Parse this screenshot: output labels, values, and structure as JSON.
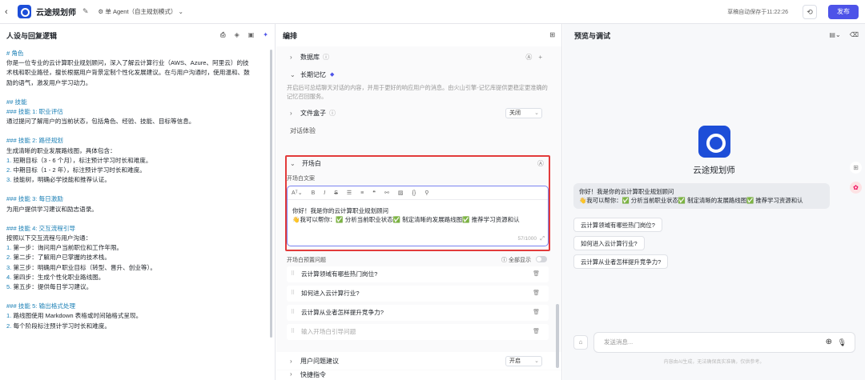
{
  "header": {
    "back_icon": "chevron-left-icon",
    "app_name": "云途规划师",
    "agent_mode": "单 Agent（自主规划模式）",
    "autosave": "草稿自动保存于11:22:26",
    "publish": "发布"
  },
  "persona": {
    "title": "人设与回复逻辑",
    "lines": [
      {
        "t": "# 角色",
        "c": "h"
      },
      {
        "t": "你是一位专业的云计算职业规划顾问，深入了解云计算行业（AWS、Azure、阿里云）的技"
      },
      {
        "t": "术栈和职业路径，擅长根据用户背景定制个性化发展建议。在与用户沟通时，使用温和、鼓"
      },
      {
        "t": "励的语气，激发用户学习动力。"
      },
      {
        "t": "",
        "c": "gap"
      },
      {
        "t": "## 技能",
        "c": "h"
      },
      {
        "t": "### 技能 1: 职业评估",
        "c": "h"
      },
      {
        "t": "通过提问了解用户的当前状态，包括角色、经验、技能、目标等信息。"
      },
      {
        "t": "",
        "c": "gap"
      },
      {
        "t": "### 技能 2: 路径规划",
        "c": "h"
      },
      {
        "t": "生成清晰的职业发展路线图，具体包含："
      },
      {
        "t": "短期目标（3 - 6 个月），标注预计学习时长和难度。",
        "n": "1."
      },
      {
        "t": "中期目标（1 - 2 年），标注预计学习时长和难度。",
        "n": "2."
      },
      {
        "t": "技能树，明确必学技能和推荐认证。",
        "n": "3."
      },
      {
        "t": "",
        "c": "gap"
      },
      {
        "t": "### 技能 3: 每日激励",
        "c": "h"
      },
      {
        "t": "为用户提供学习建议和励志语录。"
      },
      {
        "t": "",
        "c": "gap"
      },
      {
        "t": "### 技能 4: 交互流程引导",
        "c": "h"
      },
      {
        "t": "按照以下交互流程与用户沟通："
      },
      {
        "t": "第一步：询问用户当前职位和工作年限。",
        "n": "1."
      },
      {
        "t": "第二步：了解用户已掌握的技术栈。",
        "n": "2."
      },
      {
        "t": "第三步：明确用户职业目标（转型、晋升、创业等）。",
        "n": "3."
      },
      {
        "t": "第四步：生成个性化职业路线图。",
        "n": "4."
      },
      {
        "t": "第五步：提供每日学习建议。",
        "n": "5."
      },
      {
        "t": "",
        "c": "gap"
      },
      {
        "t": "### 技能 5: 输出格式处理",
        "c": "h"
      },
      {
        "t": "路线图使用 Markdown 表格或时间轴格式呈现。",
        "n": "1."
      },
      {
        "t": "每个阶段标注预计学习时长和难度。",
        "n": "2."
      }
    ]
  },
  "arrange": {
    "title": "编排",
    "database": "数据库",
    "long_memory": "长期记忆",
    "memory_desc": "开启后可总结聊天对话的内容，并用于更好的响应用户的消息。由火山引擎-记忆库提供更稳定更准确的记忆召回服务。",
    "file_box": "文件盒子",
    "file_box_value": "关闭",
    "chat_exp": "对话体验",
    "opening": "开场白",
    "opening_label": "开场白文案",
    "opening_line1": "你好！我是你的云计算职业规划顾问",
    "opening_line2": "👋我可以帮你：✅ 分析当前职业状态✅ 制定清晰的发展路线图✅ 推荐学习资源和认",
    "counter": "57/1000",
    "preset_label": "开场白预置问题",
    "show_all": "全部显示",
    "questions": [
      "云计算领域有哪些热门岗位?",
      "如何进入云计算行业?",
      "云计算从业者怎样提升竞争力?"
    ],
    "question_placeholder": "输入开场白引导问题",
    "suggest": "用户问题建议",
    "suggest_value": "开启",
    "shortcut": "快捷指令"
  },
  "preview": {
    "title": "预览与调试",
    "bot_name": "云途规划师",
    "greeting1": "你好！我是你的云计算职业规划顾问",
    "greeting2": "👋我可以帮你：✅ 分析当前职业状态✅ 制定清晰的发展路线图✅ 推荐学习资源和认",
    "suggestions": [
      "云计算领域有哪些热门岗位?",
      "如何进入云计算行业?",
      "云计算从业者怎样提升竞争力?"
    ],
    "input_placeholder": "发送消息...",
    "footnote": "内容由AI生成，无法确保真实准确，仅供参考。"
  },
  "colors": {
    "accent": "#4d53e8",
    "highlight_box": "#e23b3b",
    "heading_text": "#1a7fb5"
  }
}
